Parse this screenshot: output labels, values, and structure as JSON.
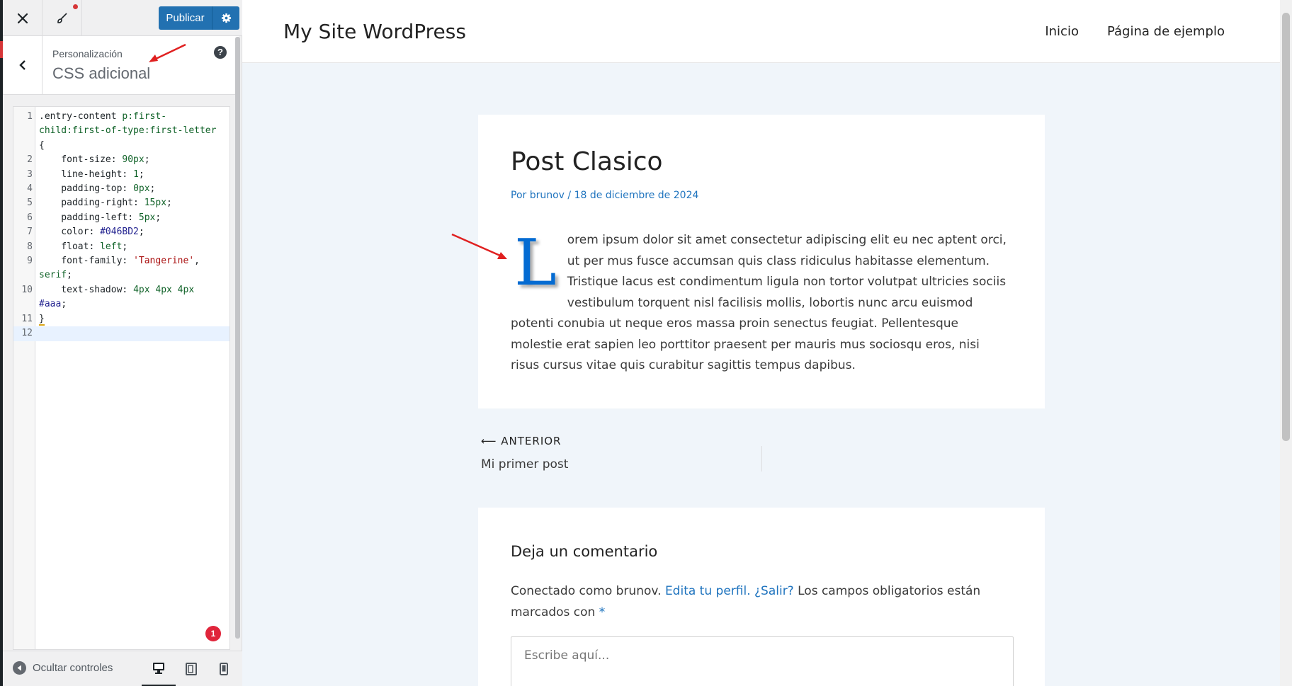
{
  "customizer": {
    "publish_label": "Publicar",
    "breadcrumb": "Personalización",
    "section_title": "CSS adicional",
    "help_glyph": "?",
    "error_count": "1",
    "collapse_label": "Ocultar controles"
  },
  "css_code": {
    "line_numbers": [
      "1",
      "",
      "",
      "2",
      "3",
      "4",
      "5",
      "6",
      "7",
      "8",
      "9",
      "",
      "10",
      "",
      "11",
      "12"
    ],
    "active_line": "12"
  },
  "site": {
    "title": "My Site WordPress",
    "nav": [
      "Inicio",
      "Página de ejemplo"
    ]
  },
  "post": {
    "title": "Post Clasico",
    "meta": "Por brunov / 18 de diciembre de 2024",
    "dropcap": "L",
    "body": "orem ipsum dolor sit amet consectetur adipiscing elit eu nec aptent orci, ut per mus fusce accumsan quis class ridiculus habitasse elementum. Tristique lacus est condimentum ligula non tortor volutpat ultricies sociis vestibulum torquent nisl facilisis mollis, lobortis nunc arcu euismod potenti conubia ut neque eros massa proin senectus feugiat. Pellentesque molestie erat sapien leo porttitor praesent per mauris mus sociosqu eros, nisi risus cursus vitae quis curabitur sagittis tempus dapibus.",
    "dropcap_color": "#046BD2"
  },
  "post_nav": {
    "prev_label": "ANTERIOR",
    "prev_title": "Mi primer post"
  },
  "comments": {
    "title": "Deja un comentario",
    "logged_prefix": "Conectado como brunov.",
    "edit_profile": "Edita tu perfil.",
    "logout": "¿Salir?",
    "required_note": "Los campos obligatorios están marcados con",
    "required_mark": "*",
    "placeholder": "Escribe aquí..."
  },
  "colors": {
    "publish_button": "#2271B1",
    "link": "#1E73BE",
    "annotation_arrow": "#E02020",
    "error_badge": "#E0253B"
  }
}
